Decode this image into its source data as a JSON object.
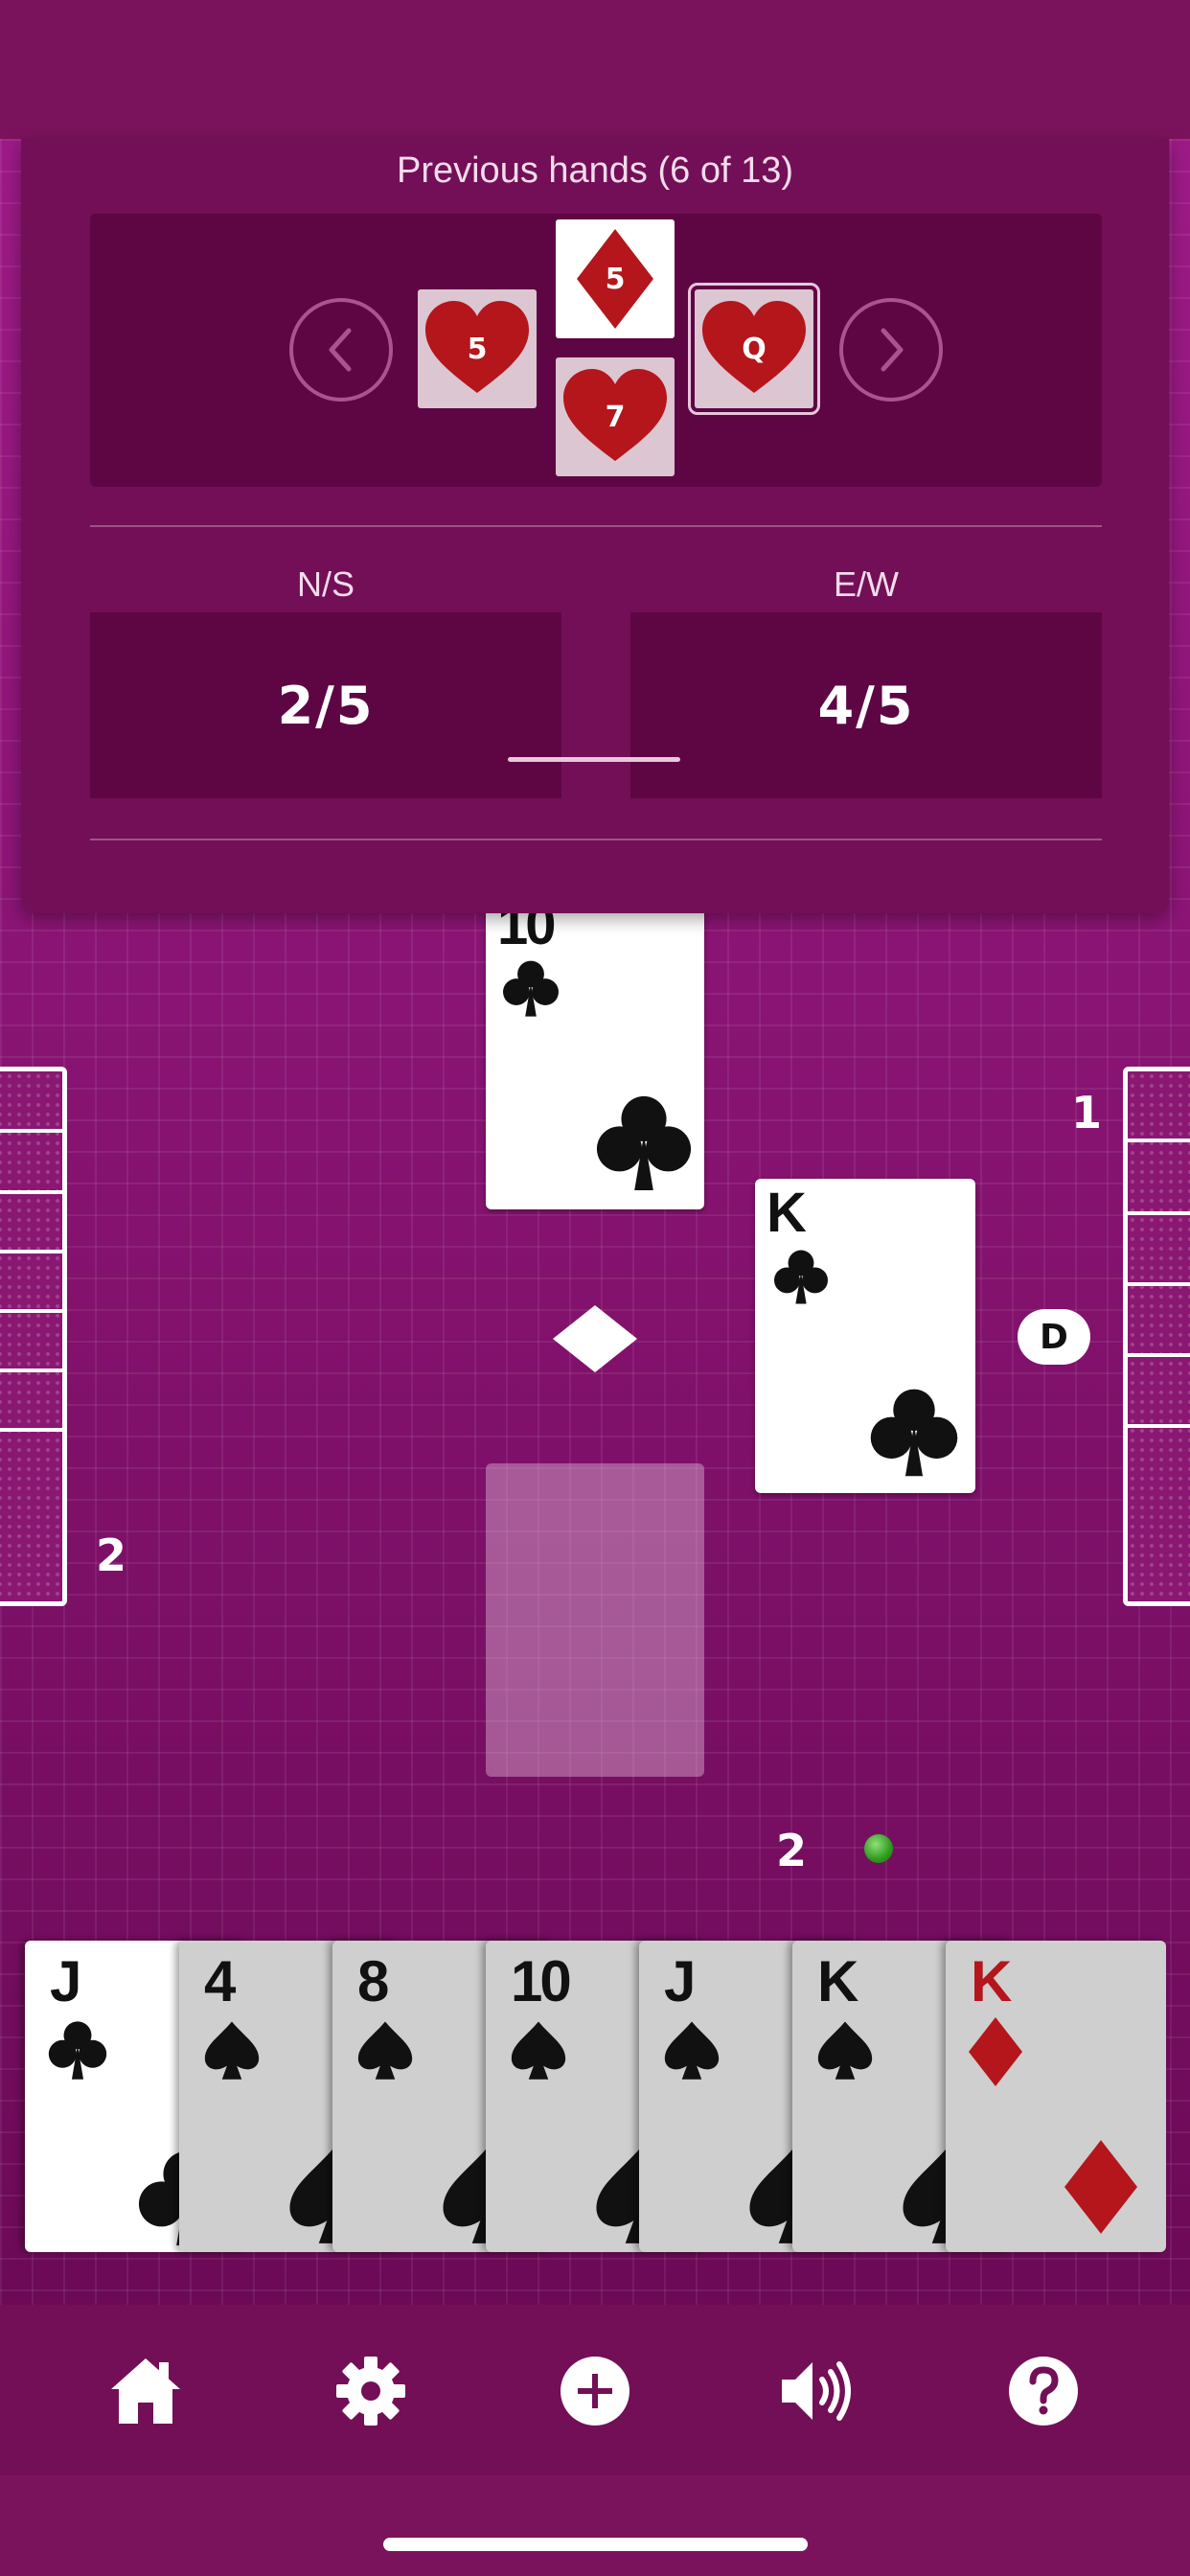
{
  "previous_hands": {
    "title": "Previous hands (6 of 13)",
    "cards": [
      {
        "rank": "5",
        "suit": "hearts",
        "position": "west"
      },
      {
        "rank": "5",
        "suit": "diamonds",
        "position": "north",
        "lead": true
      },
      {
        "rank": "7",
        "suit": "hearts",
        "position": "south"
      },
      {
        "rank": "Q",
        "suit": "hearts",
        "position": "east",
        "selected": true
      }
    ]
  },
  "scores": {
    "ns_label": "N/S",
    "ns_value": "2/5",
    "ew_label": "E/W",
    "ew_value": "4/5"
  },
  "table": {
    "north_card": {
      "rank": "10",
      "suit": "clubs"
    },
    "east_card": {
      "rank": "K",
      "suit": "clubs"
    },
    "trump_suit": "diamonds",
    "west_count": "2",
    "east_count": "1",
    "south_count": "2",
    "dealer_badge": "D"
  },
  "hand": [
    {
      "rank": "J",
      "suit": "clubs"
    },
    {
      "rank": "4",
      "suit": "spades"
    },
    {
      "rank": "8",
      "suit": "spades"
    },
    {
      "rank": "10",
      "suit": "spades"
    },
    {
      "rank": "J",
      "suit": "spades"
    },
    {
      "rank": "K",
      "suit": "spades"
    },
    {
      "rank": "K",
      "suit": "diamonds"
    }
  ],
  "toolbar": {
    "icons": [
      "home-icon",
      "gear-icon",
      "plus-circle-icon",
      "speaker-icon",
      "help-icon"
    ]
  },
  "colors": {
    "panel": "#730f56",
    "box": "#5e0644",
    "red_suit": "#b4161b"
  }
}
